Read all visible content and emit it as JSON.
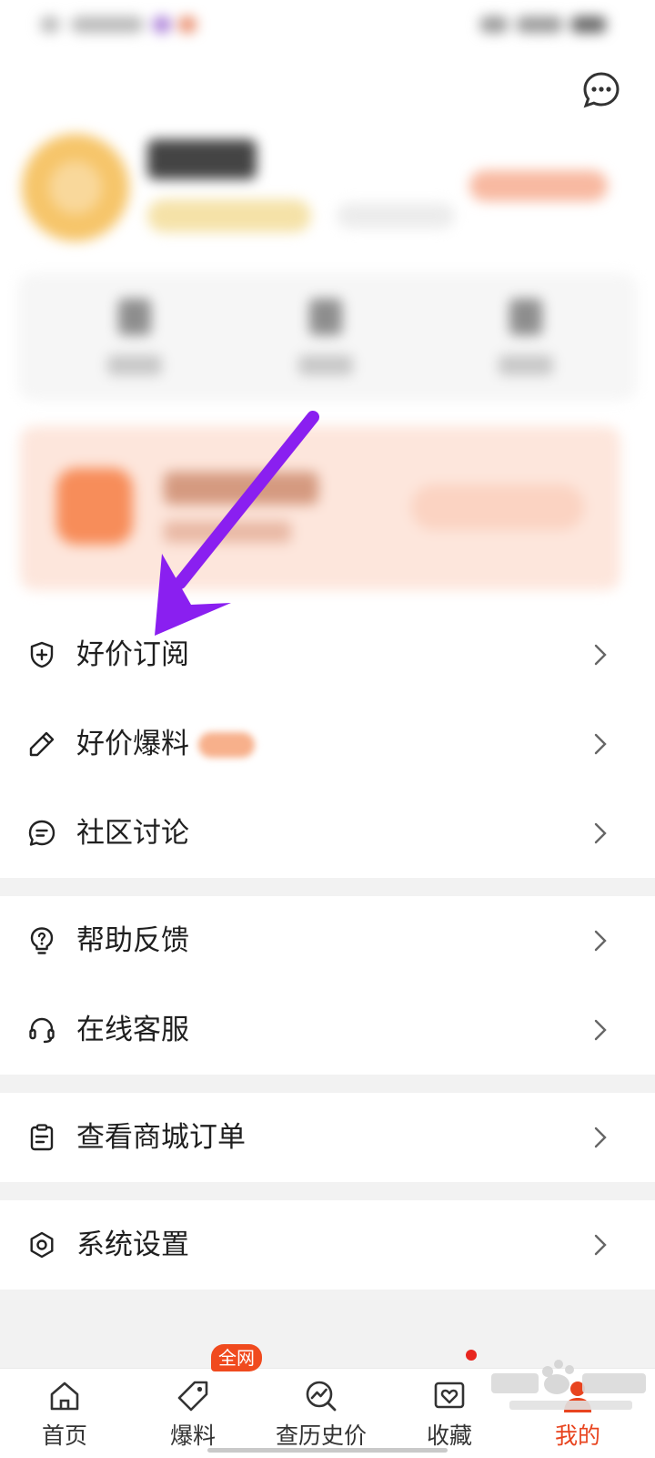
{
  "menu": {
    "group1": [
      {
        "label": "好价订阅",
        "icon": "shield-plus-icon"
      },
      {
        "label": "好价爆料",
        "icon": "pencil-icon"
      },
      {
        "label": "社区讨论",
        "icon": "chat-bubble-icon"
      }
    ],
    "group2": [
      {
        "label": "帮助反馈",
        "icon": "help-bulb-icon"
      },
      {
        "label": "在线客服",
        "icon": "headset-icon"
      }
    ],
    "group3": [
      {
        "label": "查看商城订单",
        "icon": "clipboard-icon"
      }
    ],
    "group4": [
      {
        "label": "系统设置",
        "icon": "hexagon-settings-icon"
      }
    ]
  },
  "tabbar": {
    "items": [
      {
        "label": "首页",
        "icon": "home-icon"
      },
      {
        "label": "爆料",
        "icon": "price-tag-icon"
      },
      {
        "label": "查历史价",
        "icon": "price-trend-icon"
      },
      {
        "label": "收藏",
        "icon": "favorite-heart-icon"
      },
      {
        "label": "我的",
        "icon": "profile-icon"
      }
    ],
    "active_index": 4,
    "baoliao_badge": "全网"
  },
  "colors": {
    "accent": "#e8441f",
    "arrow": "#8a1ff0",
    "section_gap": "#f2f2f2"
  }
}
